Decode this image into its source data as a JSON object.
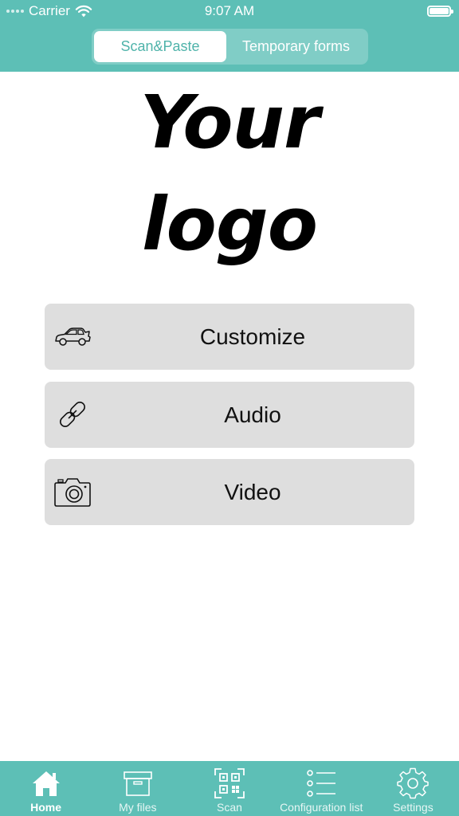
{
  "status_bar": {
    "carrier": "Carrier",
    "time": "9:07 AM"
  },
  "segmented": {
    "options": [
      {
        "label": "Scan&Paste",
        "selected": true
      },
      {
        "label": "Temporary forms",
        "selected": false
      }
    ]
  },
  "logo": {
    "line1": "Your",
    "line2": "logo"
  },
  "menu": [
    {
      "label": "Customize",
      "icon": "car-icon"
    },
    {
      "label": "Audio",
      "icon": "link-icon"
    },
    {
      "label": "Video",
      "icon": "camera-icon"
    }
  ],
  "tabbar": {
    "items": [
      {
        "label": "Home",
        "icon": "home-icon",
        "active": true
      },
      {
        "label": "My files",
        "icon": "archive-box-icon",
        "active": false
      },
      {
        "label": "Scan",
        "icon": "qr-scan-icon",
        "active": false
      },
      {
        "label": "Configuration list",
        "icon": "list-icon",
        "active": false
      },
      {
        "label": "Settings",
        "icon": "gear-icon",
        "active": false
      }
    ]
  },
  "colors": {
    "accent": "#5dbfb6",
    "button_bg": "#dedede",
    "background": "#ffffff"
  }
}
